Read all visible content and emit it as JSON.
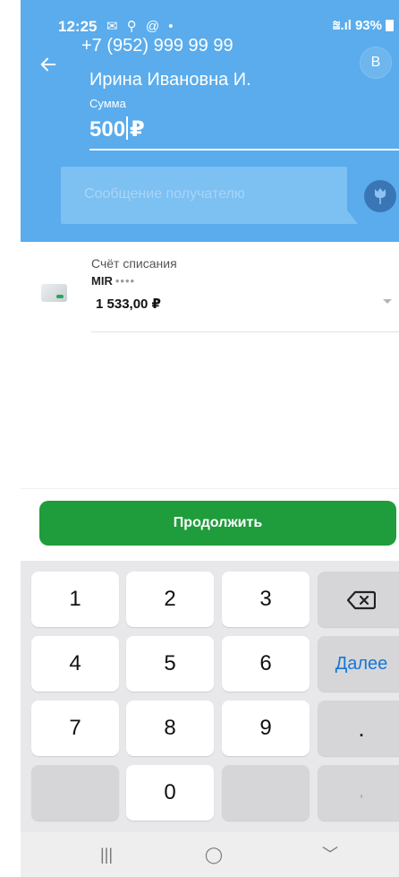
{
  "status_bar": {
    "time": "12:25",
    "left_icons": "✉ ⚲ @ •",
    "signal": "⩰.ıl",
    "battery_percent": "93%"
  },
  "header": {
    "back_icon": "arrow-left-icon",
    "phone": "+7 (952) 999 99 99",
    "recipient": "Ирина Ивановна И.",
    "avatar_letter": "В"
  },
  "amount": {
    "label": "Сумма",
    "value": "500",
    "currency": "₽"
  },
  "message": {
    "placeholder": "Сообщение получателю",
    "gift_icon": "tulip-icon"
  },
  "account": {
    "label": "Счёт списания",
    "card_name": "MIR",
    "card_mask": "••••",
    "balance": "1 533,00 ₽"
  },
  "continue_label": "Продолжить",
  "keyboard": {
    "k1": "1",
    "k2": "2",
    "k3": "3",
    "backspace": "⌫",
    "k4": "4",
    "k5": "5",
    "k6": "6",
    "next": "Далее",
    "k7": "7",
    "k8": "8",
    "k9": "9",
    "dot": ".",
    "k0": "0",
    "comma": ","
  },
  "nav": {
    "recents": "|||",
    "home": "◯",
    "back": "﹀"
  },
  "colors": {
    "header_blue": "#5aacec",
    "button_green": "#1f9c3b",
    "next_blue": "#1577d8"
  }
}
